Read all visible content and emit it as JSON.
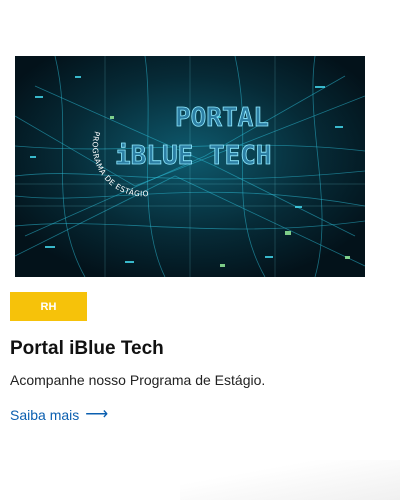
{
  "card": {
    "image": {
      "title_line1": "PORTAL",
      "title_line2": "iBLUE TECH",
      "arc_text": "PROGRAMA DE ESTÁGIO",
      "bg_color": "#04141c",
      "glow_color": "#37d4ef"
    },
    "tag": {
      "label": "RH",
      "color": "#f6c20a"
    },
    "title": "Portal iBlue Tech",
    "description": "Acompanhe nosso Programa de Estágio.",
    "link": {
      "label": "Saiba mais",
      "arrow": "⟶",
      "color": "#0b5fb0"
    }
  }
}
